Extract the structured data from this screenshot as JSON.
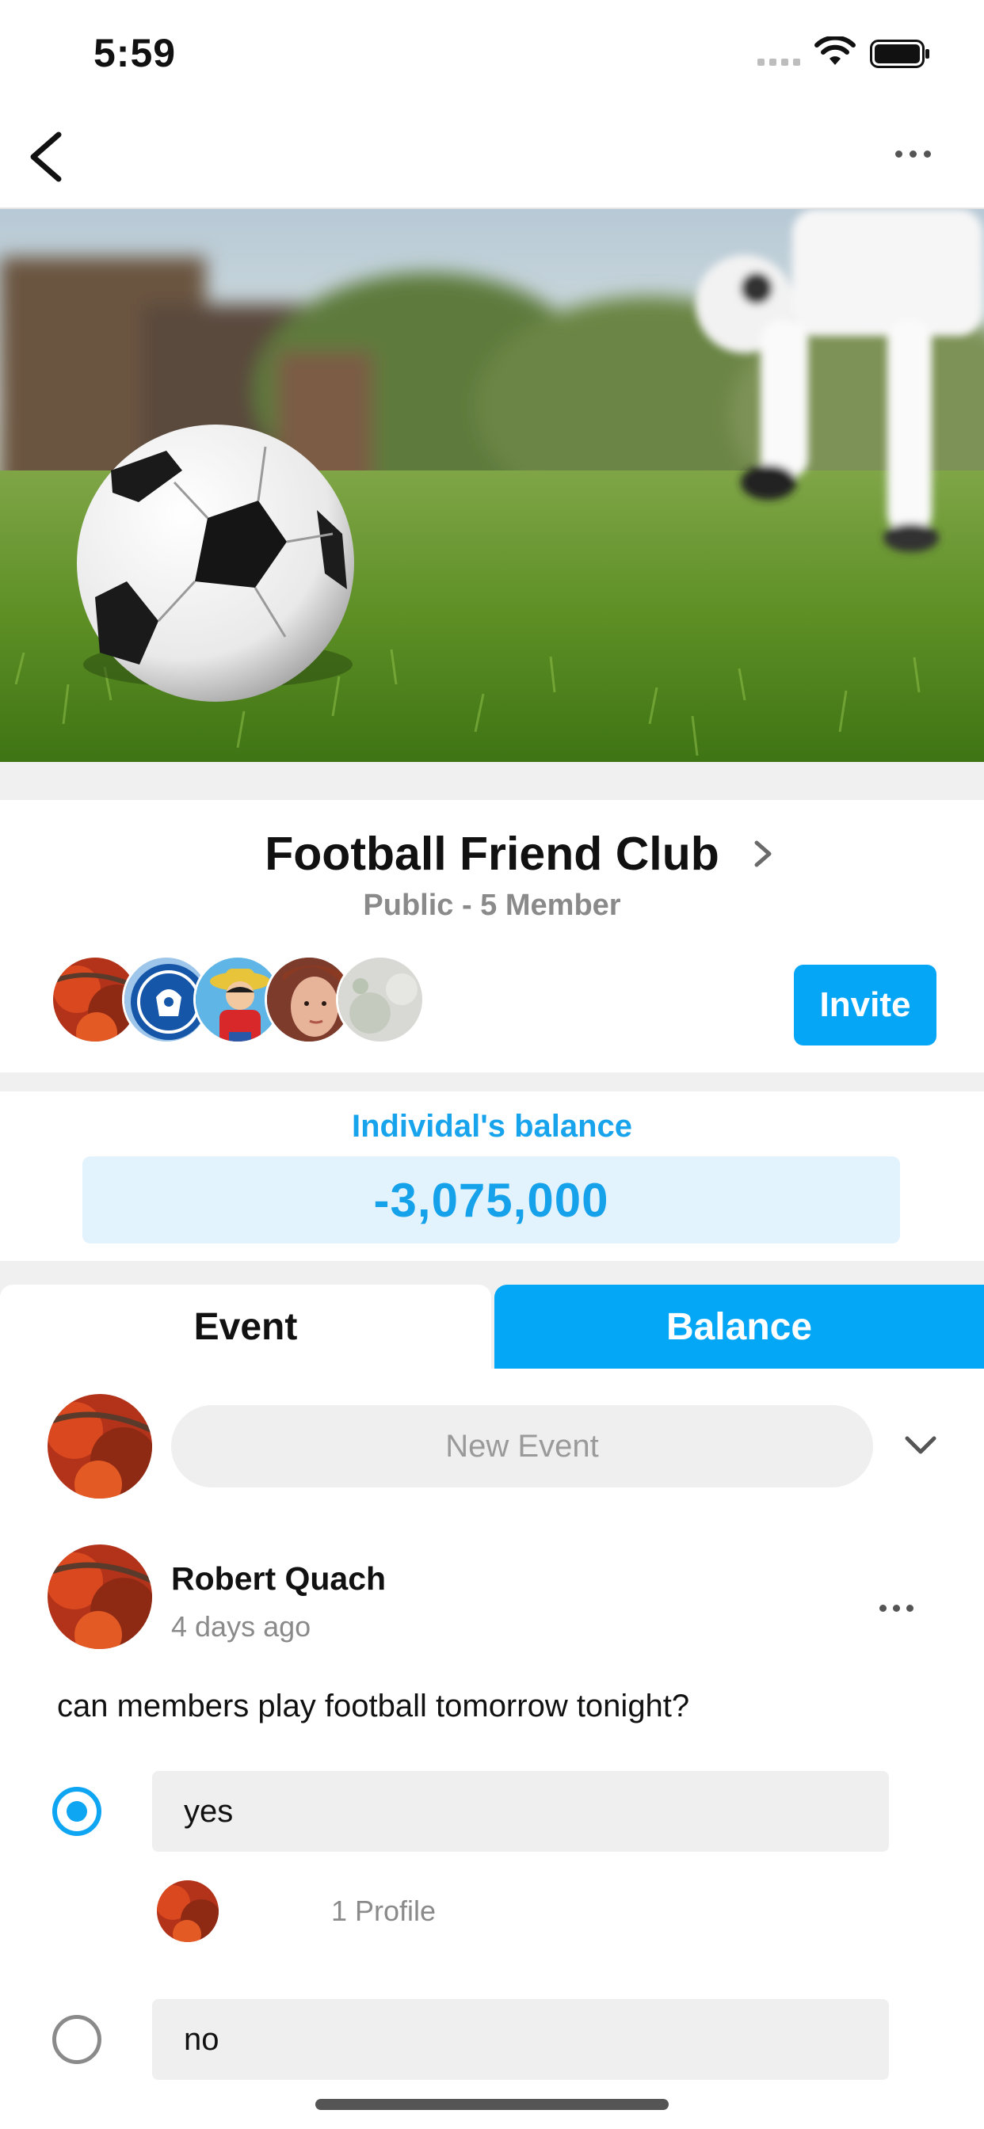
{
  "status_bar": {
    "time": "5:59"
  },
  "nav": {
    "back_icon": "chevron-left-icon",
    "more_icon": "more-horizontal-icon"
  },
  "group": {
    "title": "Football Friend Club",
    "subtitle": "Public - 5 Member",
    "invite_label": "Invite",
    "members": [
      "red-foliage-avatar",
      "chelsea-badge-avatar",
      "anime-pirate-avatar",
      "portrait-girl-avatar",
      "gray-blank-avatar"
    ]
  },
  "balance": {
    "label": "Individal's balance",
    "value": "-3,075,000"
  },
  "tabs": {
    "event": "Event",
    "balance": "Balance"
  },
  "composer": {
    "placeholder": "New Event"
  },
  "post": {
    "author": "Robert Quach",
    "time": "4 days ago",
    "question": "can members play football tomorrow tonight?",
    "options": [
      {
        "label": "yes",
        "selected": true,
        "voters": "1 Profile"
      },
      {
        "label": "no",
        "selected": false
      }
    ]
  },
  "colors": {
    "accent": "#03a7f5",
    "balance_bg": "#e2f3fd",
    "muted": "#8a8a8a"
  }
}
